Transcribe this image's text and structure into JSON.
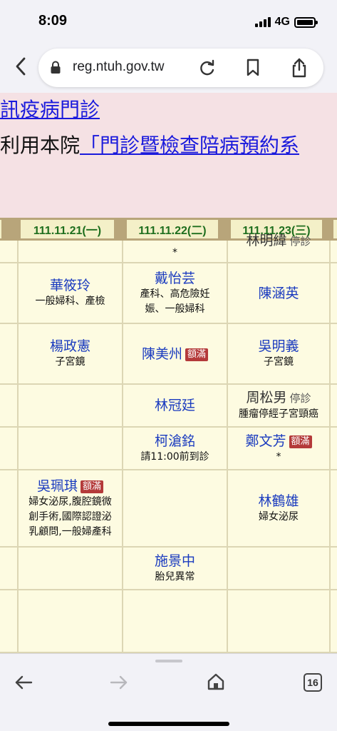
{
  "status": {
    "time": "8:09",
    "network": "4G"
  },
  "browser": {
    "url": "reg.ntuh.gov.tw",
    "tab_count": "16"
  },
  "banner": {
    "line1": "訊疫病門診",
    "line2_prefix": "利用本院",
    "line2_link": "「門診暨檢查陪病預約系"
  },
  "dates": [
    "111.11.21(一)",
    "111.11.22(二)",
    "111.11.23(三)"
  ],
  "schedule": {
    "r0": {
      "c2_star": "*",
      "c3_doc": "林明緯",
      "c3_tag": "停診"
    },
    "r1": {
      "c1_doc": "華筱玲",
      "c1_spec": "一般婦科、產檢",
      "c2_doc": "戴怡芸",
      "c2_spec1": "產科、高危險妊",
      "c2_spec2": "娠、一般婦科",
      "c3_doc": "陳涵英"
    },
    "r2": {
      "c1_doc": "楊政憲",
      "c1_spec": "子宮鏡",
      "c2_doc": "陳美州",
      "c2_badge": "額滿",
      "c3_doc": "吳明義",
      "c3_spec": "子宮鏡"
    },
    "r3": {
      "c2_doc": "林冠廷",
      "c3_doc": "周松男",
      "c3_tag": "停診",
      "c3_spec": "腫瘤停經子宮頸癌"
    },
    "r4": {
      "c2_doc": "柯滄銘",
      "c2_spec": "請11:00前到診",
      "c3_doc": "鄭文芳",
      "c3_badge": "額滿",
      "c3_spec": "*"
    },
    "r5": {
      "c1_doc": "吳珮琪",
      "c1_badge": "額滿",
      "c1_spec1": "婦女泌尿,腹腔鏡微",
      "c1_spec2": "創手術,國際認證泌",
      "c1_spec3": "乳顧問,一般婦產科",
      "c3_doc": "林鶴雄",
      "c3_spec": "婦女泌尿"
    },
    "r6": {
      "c2_doc": "施景中",
      "c2_spec": "胎兒異常"
    }
  }
}
